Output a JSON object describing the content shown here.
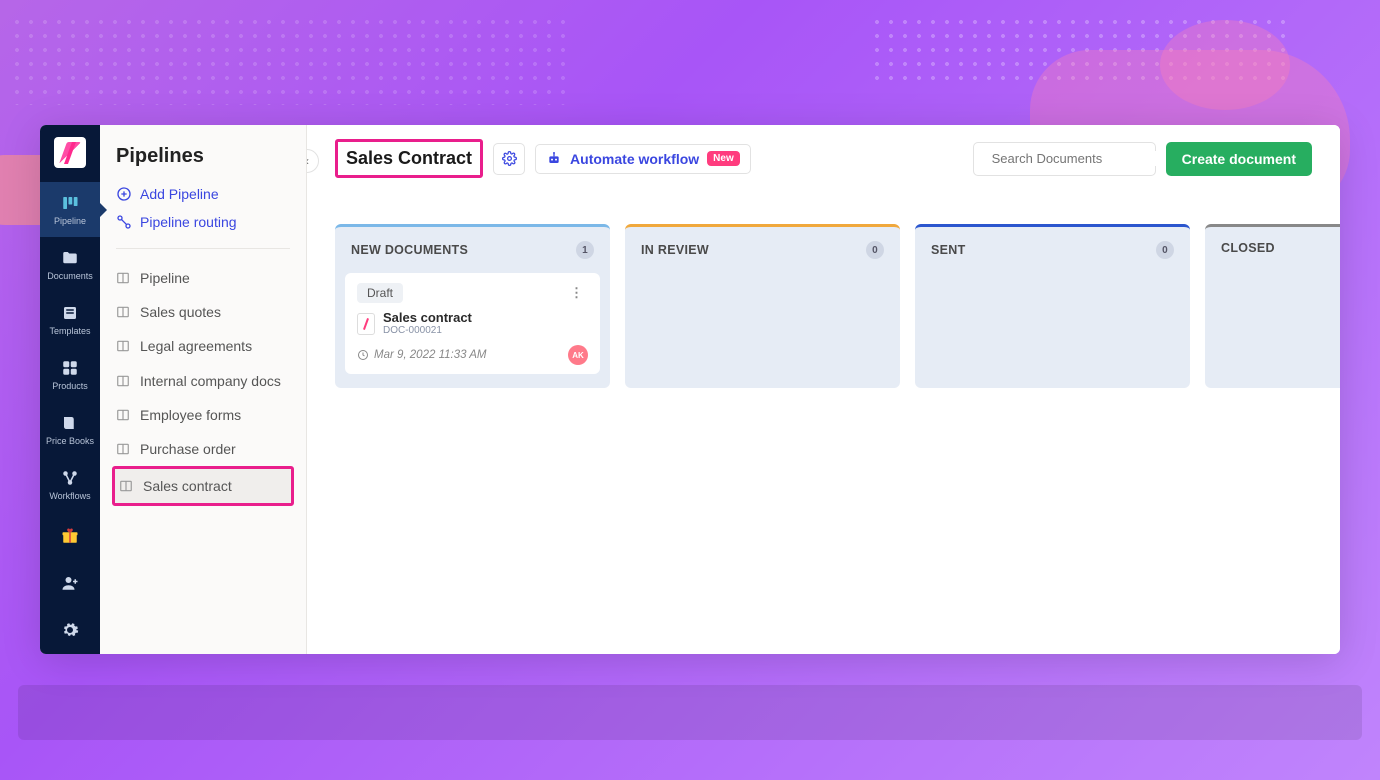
{
  "nav_rail": {
    "items": [
      {
        "label": "Pipeline"
      },
      {
        "label": "Documents"
      },
      {
        "label": "Templates"
      },
      {
        "label": "Products"
      },
      {
        "label": "Price Books"
      },
      {
        "label": "Workflows"
      }
    ]
  },
  "sidebar": {
    "title": "Pipelines",
    "actions": {
      "add": "Add Pipeline",
      "routing": "Pipeline routing"
    },
    "list": [
      "Pipeline",
      "Sales quotes",
      "Legal agreements",
      "Internal company docs",
      "Employee forms",
      "Purchase order",
      "Sales contract"
    ]
  },
  "header": {
    "title": "Sales Contract",
    "automate": "Automate workflow",
    "automate_badge": "New",
    "search_placeholder": "Search Documents",
    "create": "Create document"
  },
  "columns": [
    {
      "name": "NEW DOCUMENTS",
      "count": "1",
      "color": "#7bb8e8"
    },
    {
      "name": "IN REVIEW",
      "count": "0",
      "color": "#f0a83c"
    },
    {
      "name": "SENT",
      "count": "0",
      "color": "#2b56ce"
    },
    {
      "name": "CLOSED",
      "count": "",
      "color": "#888"
    }
  ],
  "card": {
    "status": "Draft",
    "title": "Sales contract",
    "doc_id": "DOC-000021",
    "time": "Mar 9, 2022 11:33 AM",
    "avatar": "AK"
  }
}
